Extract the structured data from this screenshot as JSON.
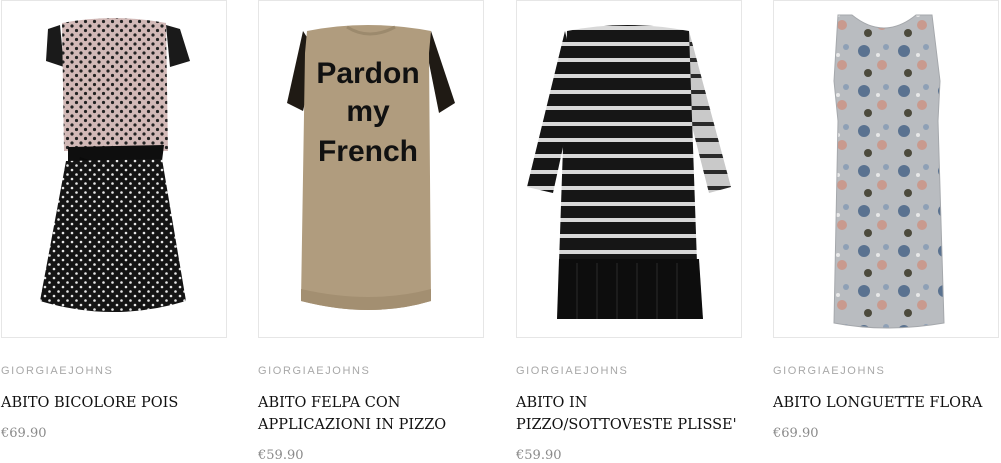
{
  "products": [
    {
      "brand": "GIORGIAEJOHNS",
      "title": "ABITO BICOLORE POIS",
      "price": "€69.90",
      "image_icon": "dress-polka-dot-image"
    },
    {
      "brand": "GIORGIAEJOHNS",
      "title": "ABITO FELPA CON\nAPPLICAZIONI IN PIZZO",
      "price": "€59.90",
      "image_icon": "sweatshirt-dress-image",
      "print_lines": [
        "Pardon",
        "my",
        "French"
      ]
    },
    {
      "brand": "GIORGIAEJOHNS",
      "title": "ABITO IN\nPIZZO/SOTTOVESTE PLISSE'",
      "price": "€59.90",
      "image_icon": "lace-dress-image"
    },
    {
      "brand": "GIORGIAEJOHNS",
      "title": "ABITO LONGUETTE FLORA",
      "price": "€69.90",
      "image_icon": "floral-dress-image"
    }
  ],
  "colors": {
    "brand": "#a8a8a8",
    "title": "#111111",
    "price": "#8a8a8a",
    "border": "#e6e6e6"
  }
}
